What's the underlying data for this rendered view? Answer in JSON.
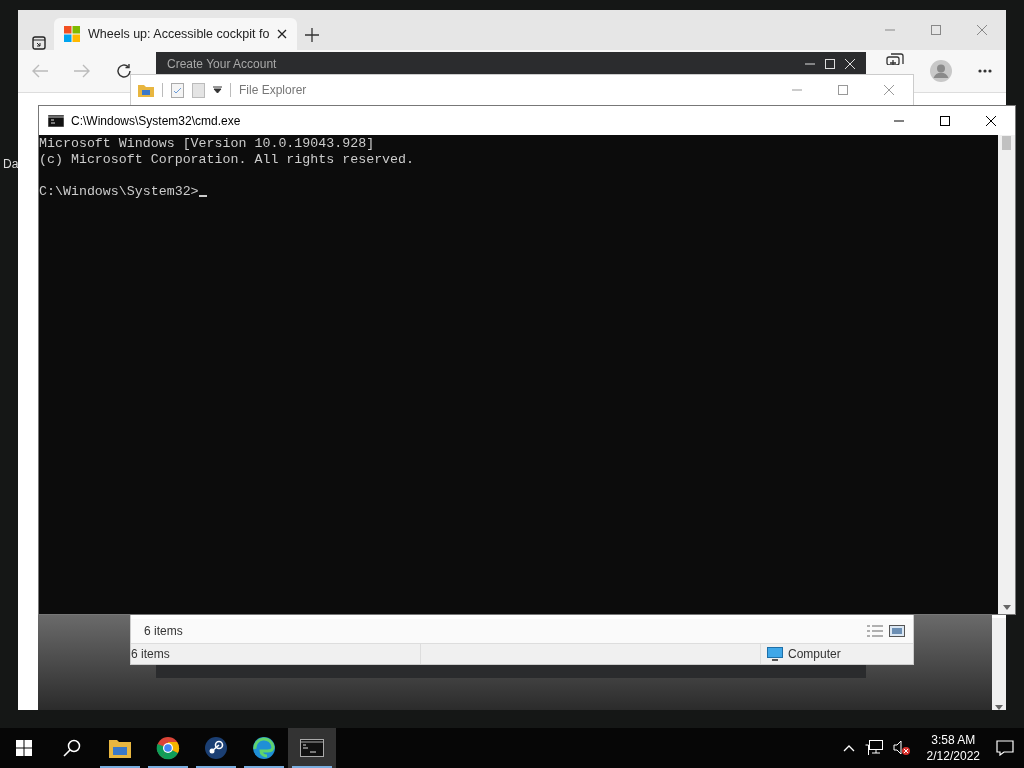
{
  "desktop_fragment": "Da",
  "browser": {
    "tab": {
      "title": "Wheels up: Accessible cockpit fo",
      "selected": true
    }
  },
  "account_dialog": {
    "title": "Create Your Account"
  },
  "file_explorer": {
    "title": "File Explorer",
    "item_count": "6 items",
    "status_bar": {
      "items": "6 items",
      "location": "Computer"
    }
  },
  "cmd": {
    "title": "C:\\Windows\\System32\\cmd.exe",
    "output": [
      "Microsoft Windows [Version 10.0.19043.928]",
      "(c) Microsoft Corporation. All rights reserved."
    ],
    "prompt": "C:\\Windows\\System32>"
  },
  "taskbar": {
    "apps": [
      {
        "kind": "folder",
        "running": true,
        "selected": false
      },
      {
        "kind": "round-browser",
        "running": true,
        "selected": false
      },
      {
        "kind": "circle-logo",
        "running": true,
        "selected": false
      },
      {
        "kind": "wave-browser",
        "running": true,
        "selected": false
      },
      {
        "kind": "terminal",
        "running": true,
        "selected": true
      }
    ],
    "clock": {
      "time": "3:58 AM",
      "date": "2/12/2022"
    }
  }
}
